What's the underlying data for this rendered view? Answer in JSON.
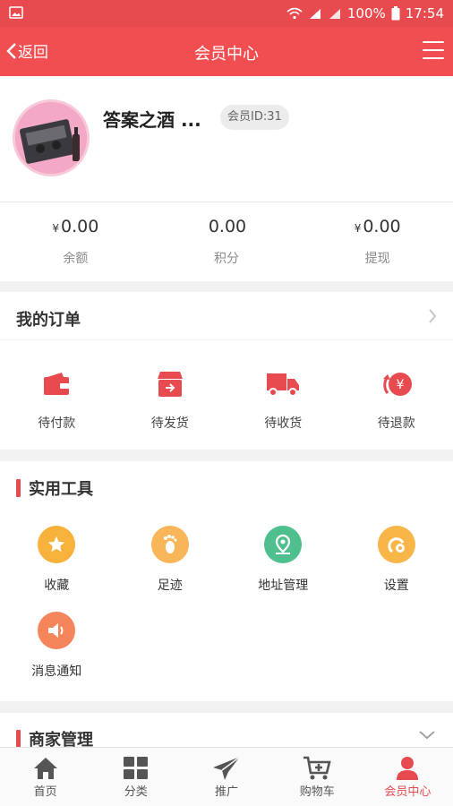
{
  "status_bar": {
    "battery": "100%",
    "time": "17:54"
  },
  "nav": {
    "back_label": "返回",
    "title": "会员中心"
  },
  "profile": {
    "username": "答案之酒 ...",
    "member_id": "会员ID:31"
  },
  "balances": [
    {
      "currency": "¥",
      "value": "0.00",
      "label": "余额"
    },
    {
      "currency": "",
      "value": "0.00",
      "label": "积分"
    },
    {
      "currency": "¥",
      "value": "0.00",
      "label": "提现"
    }
  ],
  "orders": {
    "title": "我的订单",
    "items": [
      {
        "label": "待付款",
        "icon": "wallet-icon"
      },
      {
        "label": "待发货",
        "icon": "box-icon"
      },
      {
        "label": "待收货",
        "icon": "truck-icon"
      },
      {
        "label": "待退款",
        "icon": "refund-icon"
      }
    ]
  },
  "tools": {
    "title": "实用工具",
    "items": [
      {
        "label": "收藏",
        "icon": "star-icon",
        "color": "#f7b23b"
      },
      {
        "label": "足迹",
        "icon": "footprint-icon",
        "color": "#f8b55a"
      },
      {
        "label": "地址管理",
        "icon": "location-icon",
        "color": "#4fc08d"
      },
      {
        "label": "设置",
        "icon": "settings-icon",
        "color": "#f8b548"
      },
      {
        "label": "消息通知",
        "icon": "speaker-icon",
        "color": "#f5855a"
      }
    ]
  },
  "merchant": {
    "title": "商家管理"
  },
  "tabbar": [
    {
      "label": "首页",
      "icon": "home-icon"
    },
    {
      "label": "分类",
      "icon": "grid-icon"
    },
    {
      "label": "推广",
      "icon": "paper-plane-icon"
    },
    {
      "label": "购物车",
      "icon": "cart-icon"
    },
    {
      "label": "会员中心",
      "icon": "user-icon",
      "active": true
    }
  ],
  "colors": {
    "brand": "#f04e51",
    "accent": "#e84b4f"
  }
}
